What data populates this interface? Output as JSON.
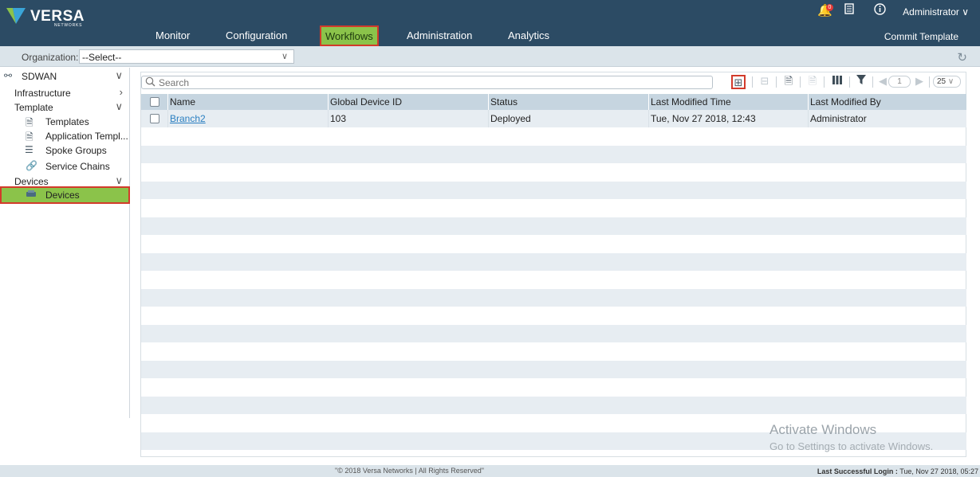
{
  "brand": {
    "name": "VERSA",
    "sub": "NETWORKS"
  },
  "header": {
    "nav": [
      "Monitor",
      "Configuration",
      "Workflows",
      "Administration",
      "Analytics"
    ],
    "active_nav": "Workflows",
    "notification_count": "0",
    "user": "Administrator",
    "commit_label": "Commit Template"
  },
  "org": {
    "label": "Organization:",
    "value": "--Select--"
  },
  "sidebar": {
    "root": "SDWAN",
    "items": [
      {
        "label": "Infrastructure"
      },
      {
        "label": "Template"
      },
      {
        "label": "Templates"
      },
      {
        "label": "Application Templ..."
      },
      {
        "label": "Spoke Groups"
      },
      {
        "label": "Service Chains"
      },
      {
        "label": "Devices"
      },
      {
        "label": "Devices"
      }
    ]
  },
  "toolbar": {
    "search_placeholder": "Search",
    "page": "1",
    "page_size": "25"
  },
  "table": {
    "columns": [
      "Name",
      "Global Device ID",
      "Status",
      "Last Modified Time",
      "Last Modified By"
    ],
    "rows": [
      [
        "Branch2",
        "103",
        "Deployed",
        "Tue, Nov 27 2018, 12:43",
        "Administrator"
      ]
    ]
  },
  "watermark": {
    "line1": "Activate Windows",
    "line2": "Go to Settings to activate Windows."
  },
  "footer": {
    "copyright": "\"© 2018 Versa Networks | All Rights Reserved\"",
    "last_login_label": "Last Successful Login :",
    "last_login_value": "Tue, Nov 27 2018, 05:27"
  },
  "colors": {
    "header": "#2c4b64",
    "active": "#8bc34a",
    "highlight": "#d23b2b",
    "link": "#2a7fc1"
  }
}
